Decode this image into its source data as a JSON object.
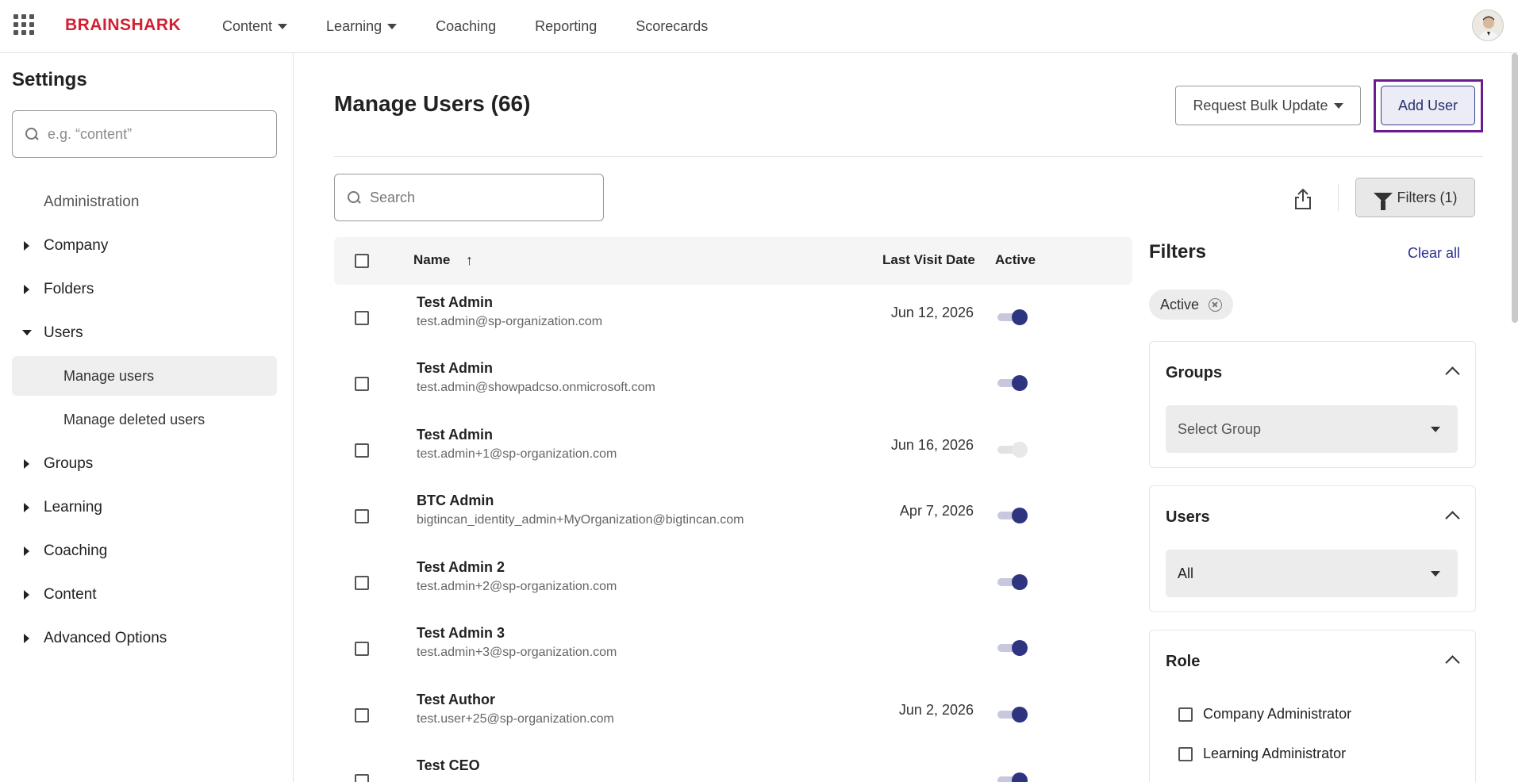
{
  "app": {
    "logo_text": "BRAINSHARK"
  },
  "topnav": {
    "items": [
      {
        "label": "Content",
        "has_caret": true
      },
      {
        "label": "Learning",
        "has_caret": true
      },
      {
        "label": "Coaching",
        "has_caret": false
      },
      {
        "label": "Reporting",
        "has_caret": false
      },
      {
        "label": "Scorecards",
        "has_caret": false
      }
    ]
  },
  "sidebar": {
    "title": "Settings",
    "search_placeholder": "e.g. “content”",
    "admin_label": "Administration",
    "items": [
      {
        "label": "Company",
        "expanded": false
      },
      {
        "label": "Folders",
        "expanded": false
      },
      {
        "label": "Users",
        "expanded": true,
        "children": [
          {
            "label": "Manage users",
            "active": true
          },
          {
            "label": "Manage deleted users",
            "active": false
          }
        ]
      },
      {
        "label": "Groups",
        "expanded": false
      },
      {
        "label": "Learning",
        "expanded": false
      },
      {
        "label": "Coaching",
        "expanded": false
      },
      {
        "label": "Content",
        "expanded": false
      },
      {
        "label": "Advanced Options",
        "expanded": false
      }
    ]
  },
  "main": {
    "title": "Manage Users (66)",
    "bulk_update_label": "Request Bulk Update",
    "add_user_label": "Add User",
    "search_placeholder": "Search",
    "filters_button_label": "Filters (1)",
    "table": {
      "headers": {
        "name": "Name",
        "sort_arrow": "↑",
        "last_visit": "Last Visit Date",
        "active": "Active"
      },
      "rows": [
        {
          "name": "Test Admin",
          "email": "test.admin@sp-organization.com",
          "last_visit": "Jun 12, 2026",
          "active": true
        },
        {
          "name": "Test Admin",
          "email": "test.admin@showpadcso.onmicrosoft.com",
          "last_visit": "",
          "active": true
        },
        {
          "name": "Test Admin",
          "email": "test.admin+1@sp-organization.com",
          "last_visit": "Jun 16, 2026",
          "active": false
        },
        {
          "name": "BTC Admin",
          "email": "bigtincan_identity_admin+MyOrganization@bigtincan.com",
          "last_visit": "Apr 7, 2026",
          "active": true
        },
        {
          "name": "Test Admin 2",
          "email": "test.admin+2@sp-organization.com",
          "last_visit": "",
          "active": true
        },
        {
          "name": "Test Admin 3",
          "email": "test.admin+3@sp-organization.com",
          "last_visit": "",
          "active": true
        },
        {
          "name": "Test Author",
          "email": "test.user+25@sp-organization.com",
          "last_visit": "Jun 2, 2026",
          "active": true
        },
        {
          "name": "Test CEO",
          "email": "",
          "last_visit": "",
          "active": true
        }
      ]
    }
  },
  "filters": {
    "title": "Filters",
    "clear_all_label": "Clear all",
    "active_chip": "Active",
    "groups": {
      "title": "Groups",
      "placeholder": "Select Group"
    },
    "users": {
      "title": "Users",
      "value": "All"
    },
    "role": {
      "title": "Role",
      "options": [
        "Company Administrator",
        "Learning Administrator"
      ]
    }
  },
  "colors": {
    "brand_red": "#d31f2f",
    "accent_navy": "#2f3480",
    "focus_purple": "#6b1a8f"
  }
}
